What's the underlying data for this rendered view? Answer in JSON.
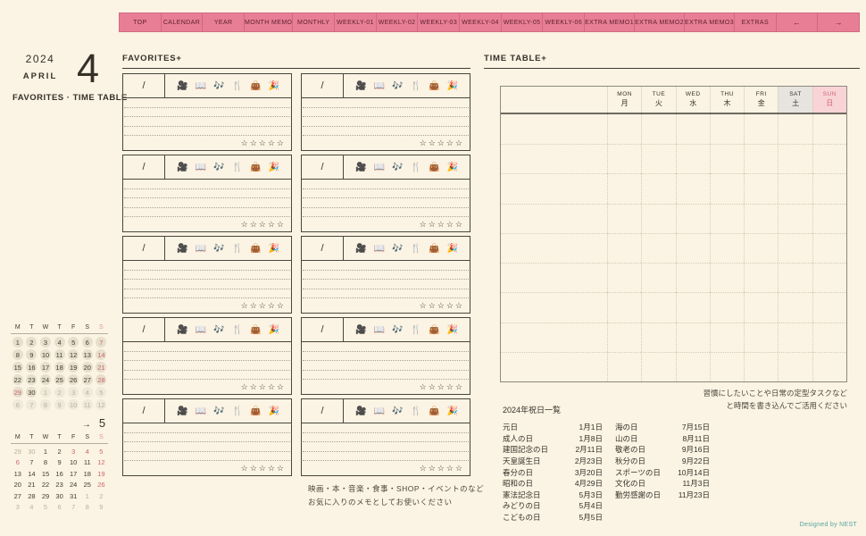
{
  "nav": {
    "items": [
      "TOP",
      "CALENDAR",
      "YEAR",
      "MONTH MEMO",
      "MONTHLY",
      "WEEKLY-01",
      "WEEKLY-02",
      "WEEKLY-03",
      "WEEKLY-04",
      "WEEKLY-05",
      "WEEKLY-06",
      "EXTRA MEMO1",
      "EXTRA MEMO2",
      "EXTRA MEMO3",
      "EXTRAS",
      "←",
      "→"
    ]
  },
  "sidebar": {
    "year": "2024",
    "month_name": "APRIL",
    "month_number": "4",
    "page_title": "FAVORITES · TIME TABLE",
    "calendar_april": {
      "weekday_headers": [
        "M",
        "T",
        "W",
        "T",
        "F",
        "S",
        "S"
      ],
      "weeks": [
        [
          {
            "d": "1",
            "s": "c"
          },
          {
            "d": "2",
            "s": "c"
          },
          {
            "d": "3",
            "s": "c"
          },
          {
            "d": "4",
            "s": "c"
          },
          {
            "d": "5",
            "s": "c"
          },
          {
            "d": "6",
            "s": "c"
          },
          {
            "d": "7",
            "s": "h"
          }
        ],
        [
          {
            "d": "8",
            "s": "c"
          },
          {
            "d": "9",
            "s": "c"
          },
          {
            "d": "10",
            "s": "c"
          },
          {
            "d": "11",
            "s": "c"
          },
          {
            "d": "12",
            "s": "c"
          },
          {
            "d": "13",
            "s": "c"
          },
          {
            "d": "14",
            "s": "h"
          }
        ],
        [
          {
            "d": "15",
            "s": "c"
          },
          {
            "d": "16",
            "s": "c"
          },
          {
            "d": "17",
            "s": "c"
          },
          {
            "d": "18",
            "s": "c"
          },
          {
            "d": "19",
            "s": "c"
          },
          {
            "d": "20",
            "s": "c"
          },
          {
            "d": "21",
            "s": "h"
          }
        ],
        [
          {
            "d": "22",
            "s": "c"
          },
          {
            "d": "23",
            "s": "c"
          },
          {
            "d": "24",
            "s": "c"
          },
          {
            "d": "25",
            "s": "c"
          },
          {
            "d": "26",
            "s": "c"
          },
          {
            "d": "27",
            "s": "c"
          },
          {
            "d": "28",
            "s": "h"
          }
        ],
        [
          {
            "d": "29",
            "s": "h"
          },
          {
            "d": "30",
            "s": "c"
          },
          {
            "d": "1",
            "s": "m"
          },
          {
            "d": "2",
            "s": "m"
          },
          {
            "d": "3",
            "s": "m"
          },
          {
            "d": "4",
            "s": "m"
          },
          {
            "d": "5",
            "s": "m"
          }
        ],
        [
          {
            "d": "6",
            "s": "m"
          },
          {
            "d": "7",
            "s": "m"
          },
          {
            "d": "8",
            "s": "m"
          },
          {
            "d": "9",
            "s": "m"
          },
          {
            "d": "10",
            "s": "m"
          },
          {
            "d": "11",
            "s": "m"
          },
          {
            "d": "12",
            "s": "m"
          }
        ]
      ]
    },
    "calendar_may": {
      "next_arrow": "→",
      "next_month_label": "5",
      "weekday_headers": [
        "M",
        "T",
        "W",
        "T",
        "F",
        "S",
        "S"
      ],
      "weeks": [
        [
          {
            "d": "29",
            "s": "m"
          },
          {
            "d": "30",
            "s": "m"
          },
          {
            "d": "1",
            "s": "c"
          },
          {
            "d": "2",
            "s": "c"
          },
          {
            "d": "3",
            "s": "h"
          },
          {
            "d": "4",
            "s": "h"
          },
          {
            "d": "5",
            "s": "h"
          }
        ],
        [
          {
            "d": "6",
            "s": "h"
          },
          {
            "d": "7",
            "s": "c"
          },
          {
            "d": "8",
            "s": "c"
          },
          {
            "d": "9",
            "s": "c"
          },
          {
            "d": "10",
            "s": "c"
          },
          {
            "d": "11",
            "s": "c"
          },
          {
            "d": "12",
            "s": "h"
          }
        ],
        [
          {
            "d": "13",
            "s": "c"
          },
          {
            "d": "14",
            "s": "c"
          },
          {
            "d": "15",
            "s": "c"
          },
          {
            "d": "16",
            "s": "c"
          },
          {
            "d": "17",
            "s": "c"
          },
          {
            "d": "18",
            "s": "c"
          },
          {
            "d": "19",
            "s": "h"
          }
        ],
        [
          {
            "d": "20",
            "s": "c"
          },
          {
            "d": "21",
            "s": "c"
          },
          {
            "d": "22",
            "s": "c"
          },
          {
            "d": "23",
            "s": "c"
          },
          {
            "d": "24",
            "s": "c"
          },
          {
            "d": "25",
            "s": "c"
          },
          {
            "d": "26",
            "s": "h"
          }
        ],
        [
          {
            "d": "27",
            "s": "c"
          },
          {
            "d": "28",
            "s": "c"
          },
          {
            "d": "29",
            "s": "c"
          },
          {
            "d": "30",
            "s": "c"
          },
          {
            "d": "31",
            "s": "c"
          },
          {
            "d": "1",
            "s": "m"
          },
          {
            "d": "2",
            "s": "m"
          }
        ],
        [
          {
            "d": "3",
            "s": "m"
          },
          {
            "d": "4",
            "s": "m"
          },
          {
            "d": "5",
            "s": "m"
          },
          {
            "d": "6",
            "s": "m"
          },
          {
            "d": "7",
            "s": "m"
          },
          {
            "d": "8",
            "s": "m"
          },
          {
            "d": "9",
            "s": "m"
          }
        ]
      ]
    }
  },
  "favorites": {
    "section_title": "FAVORITES+",
    "card_count": 10,
    "date_placeholder": "/",
    "icons": [
      {
        "name": "movie-camera-icon",
        "glyph": "🎥"
      },
      {
        "name": "open-book-icon",
        "glyph": "📖"
      },
      {
        "name": "music-notes-icon",
        "glyph": "🎶"
      },
      {
        "name": "fork-knife-icon",
        "glyph": "🍴"
      },
      {
        "name": "handbag-icon",
        "glyph": "👜"
      },
      {
        "name": "party-popper-icon",
        "glyph": "🎉"
      }
    ],
    "stars": "☆☆☆☆☆",
    "footnote_line1": "映画・本・音楽・食事・SHOP・イベントのなど",
    "footnote_line2": "お気に入りのメモとしてお使いください"
  },
  "timetable": {
    "section_title": "TIME TABLE+",
    "days": [
      {
        "en": "MON",
        "ja": "月"
      },
      {
        "en": "TUE",
        "ja": "火"
      },
      {
        "en": "WED",
        "ja": "水"
      },
      {
        "en": "THU",
        "ja": "木"
      },
      {
        "en": "FRI",
        "ja": "金"
      },
      {
        "en": "SAT",
        "ja": "土",
        "style": "sat"
      },
      {
        "en": "SUN",
        "ja": "日",
        "style": "sun"
      }
    ],
    "note_line1": "習慣にしたいことや日常の定型タスクなど",
    "note_line2": "と時間を書き込んでご活用ください"
  },
  "holidays": {
    "title": "2024年祝日一覧",
    "rows": [
      {
        "n1": "元日",
        "d1": "1月1日",
        "n2": "海の日",
        "d2": "7月15日"
      },
      {
        "n1": "成人の日",
        "d1": "1月8日",
        "n2": "山の日",
        "d2": "8月11日"
      },
      {
        "n1": "建国記念の日",
        "d1": "2月11日",
        "n2": "敬老の日",
        "d2": "9月16日"
      },
      {
        "n1": "天皇誕生日",
        "d1": "2月23日",
        "n2": "秋分の日",
        "d2": "9月22日"
      },
      {
        "n1": "春分の日",
        "d1": "3月20日",
        "n2": "スポーツの日",
        "d2": "10月14日"
      },
      {
        "n1": "昭和の日",
        "d1": "4月29日",
        "n2": "文化の日",
        "d2": "11月3日"
      },
      {
        "n1": "憲法記念日",
        "d1": "5月3日",
        "n2": "勤労感謝の日",
        "d2": "11月23日"
      },
      {
        "n1": "みどりの日",
        "d1": "5月4日",
        "n2": "",
        "d2": ""
      },
      {
        "n1": "こどもの日",
        "d1": "5月5日",
        "n2": "",
        "d2": ""
      }
    ]
  },
  "footer": {
    "credit": "Designed by NEST"
  },
  "colors": {
    "background": "#fbf3e3",
    "nav_pink": "#e87e95",
    "nav_text": "#5e2130",
    "holiday_red": "#cb6670",
    "sat_bg": "#e7e4df",
    "sun_bg": "#f8d4d7",
    "credit_teal": "#54a5a4"
  }
}
